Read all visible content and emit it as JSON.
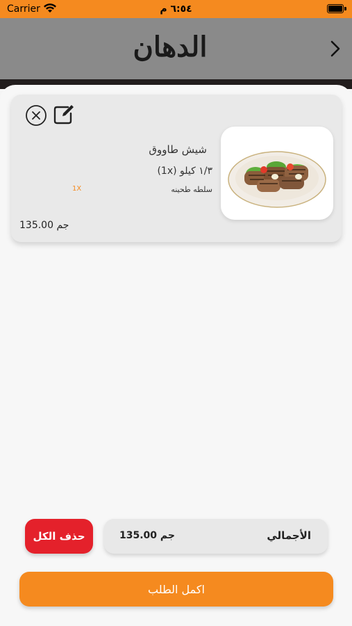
{
  "status_bar": {
    "carrier": "Carrier",
    "time": "٦:٥٤ م"
  },
  "nav_bar": {
    "logo_text": "الدهان",
    "back_icon": "chevron-right-icon"
  },
  "cart": {
    "items": [
      {
        "name": "شيش طاووق",
        "size": "١/٣ كيلو (1x)",
        "addon_name": "سلطه طحينه",
        "addon_qty": "1X",
        "price": "135.00 جم",
        "image_icon": "grilled-chicken-plate"
      }
    ]
  },
  "summary": {
    "total_label": "الأجمالي",
    "total_value": "135.00 جم",
    "delete_all_label": "حذف الكل",
    "checkout_label": "اكمل الطلب"
  },
  "colors": {
    "accent": "#f58a1f",
    "danger": "#e4212b",
    "header_gray": "#8a8a8a"
  }
}
